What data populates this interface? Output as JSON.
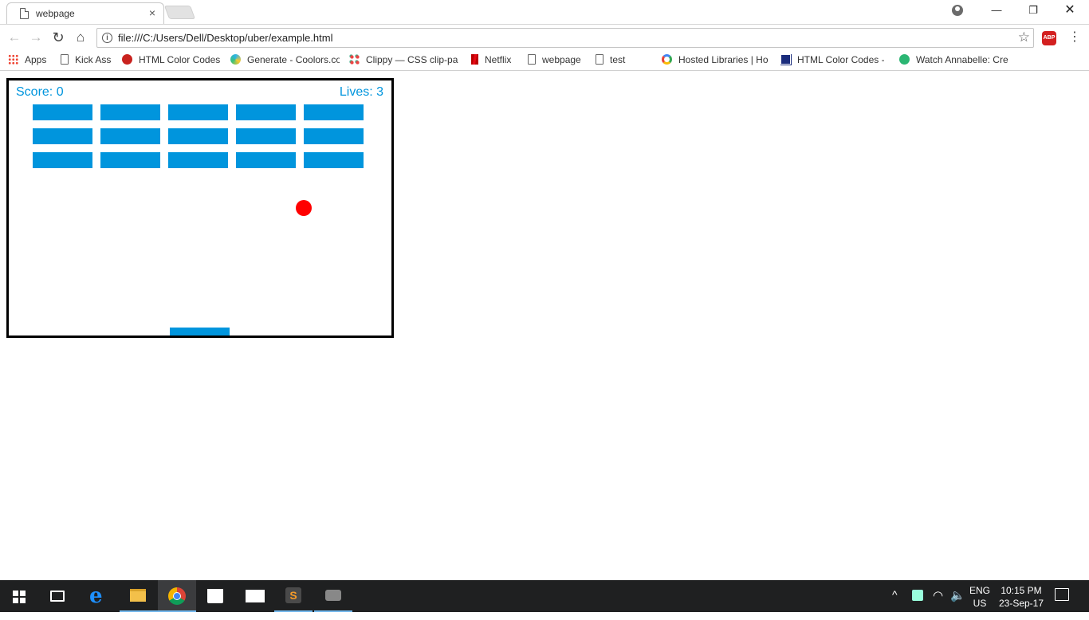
{
  "browser": {
    "tab_title": "webpage",
    "tab_close": "×",
    "window_controls": {
      "minimize": "—",
      "maximize": "❐",
      "close": "✕"
    },
    "nav": {
      "back": "←",
      "forward": "→",
      "reload": "↻",
      "home": "⌂"
    },
    "url": "file:///C:/Users/Dell/Desktop/uber/example.html",
    "star": "☆",
    "abp_label": "ABP",
    "menu": "⋮"
  },
  "bookmarks": [
    {
      "label": "Apps",
      "icon": "apps-grid-icon"
    },
    {
      "label": "Kick Ass",
      "icon": "page-icon"
    },
    {
      "label": "HTML Color Codes",
      "icon": "opera-circle-icon"
    },
    {
      "label": "Generate - Coolors.co",
      "icon": "coolors-icon"
    },
    {
      "label": "Clippy — CSS clip-pa",
      "icon": "clippy-icon"
    },
    {
      "label": "Netflix",
      "icon": "netflix-icon"
    },
    {
      "label": "webpage",
      "icon": "page-icon"
    },
    {
      "label": "test",
      "icon": "page-icon"
    },
    {
      "label": "Hosted Libraries | Ho",
      "icon": "google-icon"
    },
    {
      "label": "HTML Color Codes -",
      "icon": "html-color-codes-icon"
    },
    {
      "label": "Watch Annabelle: Cre",
      "icon": "play-icon"
    }
  ],
  "game": {
    "score_text": "Score: 0",
    "lives_text": "Lives: 3",
    "brick_rows": 3,
    "brick_cols": 5,
    "colors": {
      "brick": "#0095DD",
      "paddle": "#0095DD",
      "ball": "#FF0000",
      "text": "#0095DD"
    }
  },
  "taskbar": {
    "apps": [
      "start-icon",
      "task-view-icon",
      "edge-icon",
      "file-explorer-icon",
      "chrome-icon",
      "store-icon",
      "mail-icon",
      "sublime-text-icon",
      "app-icon"
    ],
    "tray": {
      "chevron": "^",
      "wifi": "◠",
      "volume": "🔈",
      "lang_line1": "ENG",
      "lang_line2": "US",
      "time": "10:15 PM",
      "date": "23-Sep-17"
    }
  }
}
